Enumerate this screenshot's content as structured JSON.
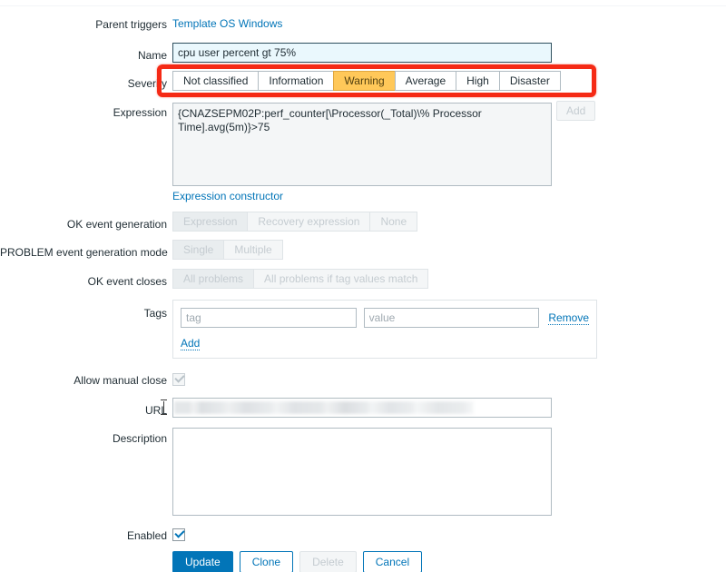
{
  "form": {
    "rows": {
      "parent_triggers": {
        "label": "Parent triggers",
        "link": "Template OS Windows"
      },
      "name": {
        "label": "Name",
        "value": "cpu user percent gt 75%"
      },
      "severity": {
        "label": "Severity",
        "options": [
          "Not classified",
          "Information",
          "Warning",
          "Average",
          "High",
          "Disaster"
        ],
        "selected": "Warning"
      },
      "expression": {
        "label": "Expression",
        "value": "{CNAZSEPM02P:perf_counter[\\Processor(_Total)\\% Processor Time].avg(5m)}>75",
        "add_label": "Add",
        "constructor_link": "Expression constructor"
      },
      "ok_event_generation": {
        "label": "OK event generation",
        "options": [
          "Expression",
          "Recovery expression",
          "None"
        ],
        "selected": "Expression",
        "disabled": true
      },
      "problem_event_generation_mode": {
        "label": "PROBLEM event generation mode",
        "options": [
          "Single",
          "Multiple"
        ],
        "selected": "Single",
        "disabled": true
      },
      "ok_event_closes": {
        "label": "OK event closes",
        "options": [
          "All problems",
          "All problems if tag values match"
        ],
        "selected": "All problems",
        "disabled": true
      },
      "tags": {
        "label": "Tags",
        "tag_placeholder": "tag",
        "tag_value": "",
        "value_placeholder": "value",
        "value_value": "",
        "remove_label": "Remove",
        "add_label": "Add"
      },
      "allow_manual_close": {
        "label": "Allow manual close",
        "checked": true,
        "disabled": true
      },
      "url": {
        "label": "URL",
        "value": "",
        "redacted": true
      },
      "description": {
        "label": "Description",
        "value": ""
      },
      "enabled": {
        "label": "Enabled",
        "checked": true
      }
    },
    "footer_buttons": {
      "update": "Update",
      "clone": "Clone",
      "delete": "Delete",
      "cancel": "Cancel"
    }
  },
  "annotation": {
    "color": "#f52a15",
    "target": "severity"
  },
  "colors": {
    "accent": "#0275b8",
    "warning": "#ffc859",
    "annotation": "#f52a15",
    "text": "#1f2c33",
    "disabled_text": "#c5ccd1"
  }
}
